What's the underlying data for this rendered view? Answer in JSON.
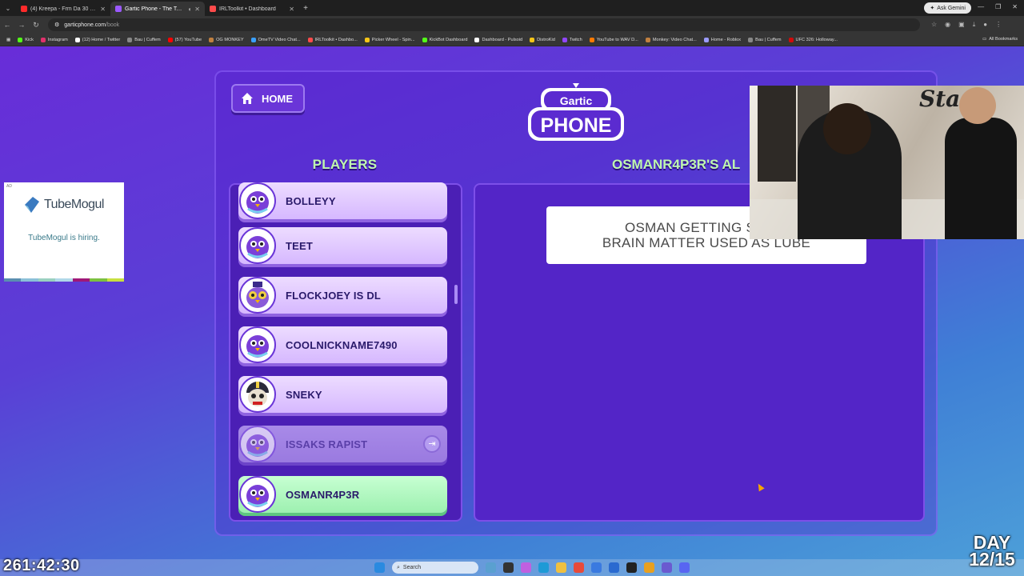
{
  "browser": {
    "tabs": [
      {
        "title": "(4) Kreepa - Frm Da 30 (Official",
        "color": "#ff2a2a",
        "active": false
      },
      {
        "title": "Gartic Phone - The Telephone",
        "color": "#9b59ff",
        "active": true
      },
      {
        "title": "IRLToolkit • Dashboard",
        "color": "#ff4b4b",
        "active": false
      }
    ],
    "ask_gemini": "Ask Gemini",
    "url": "garticphone.com",
    "url_path": "/book",
    "bookmarks": [
      {
        "label": "Kick",
        "color": "#53fc18"
      },
      {
        "label": "Instagram",
        "color": "#e1306c"
      },
      {
        "label": "(12) Home / Twitter",
        "color": "#ffffff"
      },
      {
        "label": "Bau | Cuffem",
        "color": "#888888"
      },
      {
        "label": "(57) YouTube",
        "color": "#ff0000"
      },
      {
        "label": "OG MONKEY",
        "color": "#c08040"
      },
      {
        "label": "OmeTV Video Chat...",
        "color": "#3aa0ff"
      },
      {
        "label": "IRLToolkit • Dashbo...",
        "color": "#ff4b4b"
      },
      {
        "label": "Picker Wheel - Spin...",
        "color": "#f5c518"
      },
      {
        "label": "KickBot Dashboard",
        "color": "#53fc18"
      },
      {
        "label": "Dashboard - Pulsoid",
        "color": "#ffffff"
      },
      {
        "label": "DistroKid",
        "color": "#f5c518"
      },
      {
        "label": "Twitch",
        "color": "#9146ff"
      },
      {
        "label": "YouTube to WAV D...",
        "color": "#ff7a00"
      },
      {
        "label": "Monkey: Video Chat...",
        "color": "#c08040"
      },
      {
        "label": "Home - Roblox",
        "color": "#9b9bff"
      },
      {
        "label": "Bau | Cuffem",
        "color": "#888888"
      },
      {
        "label": "UFC 326: Holloway...",
        "color": "#d20a0a"
      }
    ],
    "all_bookmarks": "All Bookmarks"
  },
  "ad": {
    "tag": "AD",
    "brand": "TubeMogul",
    "text": "TubeMogul is hiring."
  },
  "game": {
    "home_label": "HOME",
    "logo_top": "Gartic",
    "logo_bottom": "PHONE",
    "players_title": "PLAYERS",
    "album_title": "OSMANR4P3R'S AL",
    "players": [
      {
        "name": "BOLLEYY",
        "state": "normal"
      },
      {
        "name": "TEET",
        "state": "normal"
      },
      {
        "name": "FLOCKJOEY IS DL",
        "state": "normal"
      },
      {
        "name": "COOLNICKNAME7490",
        "state": "normal"
      },
      {
        "name": "SNEKY",
        "state": "normal"
      },
      {
        "name": "ISSAKS RAPIST",
        "state": "left"
      },
      {
        "name": "OSMANR4P3R",
        "state": "me"
      }
    ],
    "caption_line1": "OSMAN GETTING SNIPE",
    "caption_line2": "BRAIN MATTER USED AS LUBE"
  },
  "overlay": {
    "timer": "261:42:30",
    "day_line1": "DAY",
    "day_line2": "12/15",
    "cam_sign": "Sta"
  },
  "taskbar": {
    "search": "Search"
  }
}
